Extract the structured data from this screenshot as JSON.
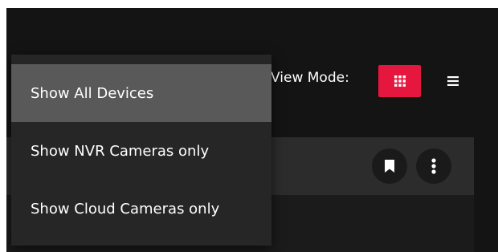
{
  "toolbar": {
    "view_mode_label": "View Mode:",
    "active_view": "grid",
    "accent_color": "#e5173e"
  },
  "device_filter_menu": {
    "items": [
      {
        "label": "Show All Devices",
        "selected": true
      },
      {
        "label": "Show NVR Cameras only",
        "selected": false
      },
      {
        "label": "Show Cloud Cameras only",
        "selected": false
      }
    ]
  },
  "device_card": {
    "actions": [
      "bookmark-icon",
      "more-vertical-icon"
    ]
  }
}
